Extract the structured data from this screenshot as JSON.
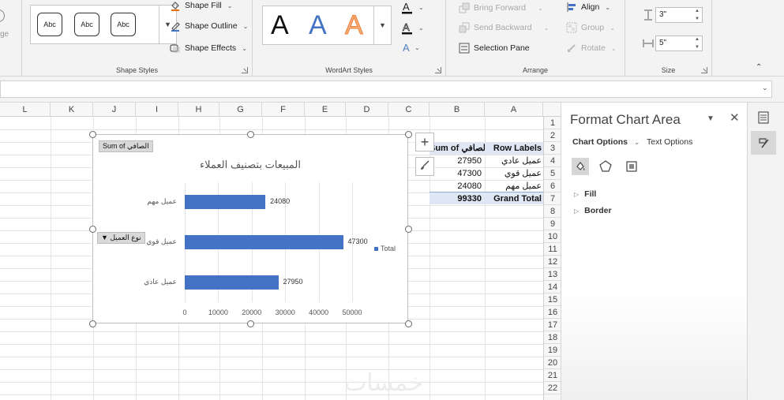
{
  "ribbon": {
    "shape_styles": {
      "group_label": "Shape Styles",
      "samples": [
        "Abc",
        "Abc",
        "Abc"
      ],
      "fill_label": "Shape Fill",
      "outline_label": "Shape Outline",
      "effects_label": "Shape Effects"
    },
    "left_partial_label": "ge",
    "wordart": {
      "group_label": "WordArt Styles",
      "letters": [
        "A",
        "A",
        "A"
      ]
    },
    "arrange": {
      "group_label": "Arrange",
      "bring_forward": "Bring Forward",
      "send_backward": "Send Backward",
      "selection_pane": "Selection Pane",
      "align": "Align",
      "group": "Group",
      "rotate": "Rotate"
    },
    "size": {
      "group_label": "Size",
      "height_value": "3\"",
      "width_value": "5\""
    }
  },
  "columns": [
    "L",
    "K",
    "J",
    "I",
    "H",
    "G",
    "F",
    "E",
    "D",
    "C",
    "B",
    "A"
  ],
  "rows": [
    "1",
    "2",
    "3",
    "4",
    "5",
    "6",
    "7",
    "8",
    "9",
    "10",
    "11",
    "12",
    "13",
    "14",
    "15",
    "16",
    "17",
    "18",
    "19",
    "20",
    "21",
    "22"
  ],
  "pivot": {
    "header_value": "Sum of الصافي",
    "header_labels": "Row Labels",
    "rows": [
      {
        "label": "عميل عادي",
        "value": "27950"
      },
      {
        "label": "عميل قوي",
        "value": "47300"
      },
      {
        "label": "عميل مهم",
        "value": "24080"
      }
    ],
    "total_label": "Grand Total",
    "total_value": "99330"
  },
  "chart": {
    "field_value_button": "Sum of الصافي",
    "field_axis_button": "نوع العميل",
    "plus_icon": "plus-icon",
    "brush_icon": "brush-icon"
  },
  "chart_data": {
    "type": "bar",
    "orientation": "horizontal",
    "title": "المبيعات بتصنيف العملاء",
    "categories": [
      "عميل مهم",
      "عميل قوي",
      "عميل عادي"
    ],
    "series": [
      {
        "name": "Total",
        "values": [
          24080,
          47300,
          27950
        ]
      }
    ],
    "data_labels": [
      "24080",
      "47300",
      "27950"
    ],
    "x_ticks": [
      "0",
      "10000",
      "20000",
      "30000",
      "40000",
      "50000"
    ],
    "xlim": [
      0,
      50000
    ],
    "bar_color": "#4472c4",
    "legend_position": "right",
    "grid": true
  },
  "pane": {
    "title": "Format Chart Area",
    "tab_chart_options": "Chart Options",
    "tab_text_options": "Text Options",
    "section_fill": "Fill",
    "section_border": "Border"
  },
  "watermark": "خمسات"
}
